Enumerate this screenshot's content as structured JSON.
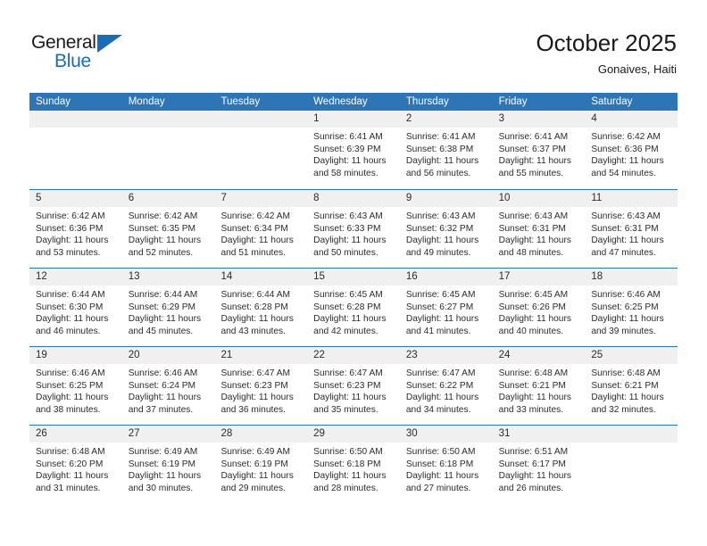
{
  "brand": {
    "name_top": "General",
    "name_bottom": "Blue",
    "accent_color": "#1a6cb5",
    "triangle_icon": "triangle-icon"
  },
  "header": {
    "title": "October 2025",
    "subtitle": "Gonaives, Haiti"
  },
  "theme": {
    "header_blue": "#2e75b6",
    "date_strip_gray": "#f0f0f0",
    "text_color": "#2b2b2b"
  },
  "weekdays": [
    "Sunday",
    "Monday",
    "Tuesday",
    "Wednesday",
    "Thursday",
    "Friday",
    "Saturday"
  ],
  "weeks": [
    [
      {
        "day": "",
        "sunrise": "",
        "sunset": "",
        "daylight1": "",
        "daylight2": ""
      },
      {
        "day": "",
        "sunrise": "",
        "sunset": "",
        "daylight1": "",
        "daylight2": ""
      },
      {
        "day": "",
        "sunrise": "",
        "sunset": "",
        "daylight1": "",
        "daylight2": ""
      },
      {
        "day": "1",
        "sunrise": "Sunrise: 6:41 AM",
        "sunset": "Sunset: 6:39 PM",
        "daylight1": "Daylight: 11 hours",
        "daylight2": "and 58 minutes."
      },
      {
        "day": "2",
        "sunrise": "Sunrise: 6:41 AM",
        "sunset": "Sunset: 6:38 PM",
        "daylight1": "Daylight: 11 hours",
        "daylight2": "and 56 minutes."
      },
      {
        "day": "3",
        "sunrise": "Sunrise: 6:41 AM",
        "sunset": "Sunset: 6:37 PM",
        "daylight1": "Daylight: 11 hours",
        "daylight2": "and 55 minutes."
      },
      {
        "day": "4",
        "sunrise": "Sunrise: 6:42 AM",
        "sunset": "Sunset: 6:36 PM",
        "daylight1": "Daylight: 11 hours",
        "daylight2": "and 54 minutes."
      }
    ],
    [
      {
        "day": "5",
        "sunrise": "Sunrise: 6:42 AM",
        "sunset": "Sunset: 6:36 PM",
        "daylight1": "Daylight: 11 hours",
        "daylight2": "and 53 minutes."
      },
      {
        "day": "6",
        "sunrise": "Sunrise: 6:42 AM",
        "sunset": "Sunset: 6:35 PM",
        "daylight1": "Daylight: 11 hours",
        "daylight2": "and 52 minutes."
      },
      {
        "day": "7",
        "sunrise": "Sunrise: 6:42 AM",
        "sunset": "Sunset: 6:34 PM",
        "daylight1": "Daylight: 11 hours",
        "daylight2": "and 51 minutes."
      },
      {
        "day": "8",
        "sunrise": "Sunrise: 6:43 AM",
        "sunset": "Sunset: 6:33 PM",
        "daylight1": "Daylight: 11 hours",
        "daylight2": "and 50 minutes."
      },
      {
        "day": "9",
        "sunrise": "Sunrise: 6:43 AM",
        "sunset": "Sunset: 6:32 PM",
        "daylight1": "Daylight: 11 hours",
        "daylight2": "and 49 minutes."
      },
      {
        "day": "10",
        "sunrise": "Sunrise: 6:43 AM",
        "sunset": "Sunset: 6:31 PM",
        "daylight1": "Daylight: 11 hours",
        "daylight2": "and 48 minutes."
      },
      {
        "day": "11",
        "sunrise": "Sunrise: 6:43 AM",
        "sunset": "Sunset: 6:31 PM",
        "daylight1": "Daylight: 11 hours",
        "daylight2": "and 47 minutes."
      }
    ],
    [
      {
        "day": "12",
        "sunrise": "Sunrise: 6:44 AM",
        "sunset": "Sunset: 6:30 PM",
        "daylight1": "Daylight: 11 hours",
        "daylight2": "and 46 minutes."
      },
      {
        "day": "13",
        "sunrise": "Sunrise: 6:44 AM",
        "sunset": "Sunset: 6:29 PM",
        "daylight1": "Daylight: 11 hours",
        "daylight2": "and 45 minutes."
      },
      {
        "day": "14",
        "sunrise": "Sunrise: 6:44 AM",
        "sunset": "Sunset: 6:28 PM",
        "daylight1": "Daylight: 11 hours",
        "daylight2": "and 43 minutes."
      },
      {
        "day": "15",
        "sunrise": "Sunrise: 6:45 AM",
        "sunset": "Sunset: 6:28 PM",
        "daylight1": "Daylight: 11 hours",
        "daylight2": "and 42 minutes."
      },
      {
        "day": "16",
        "sunrise": "Sunrise: 6:45 AM",
        "sunset": "Sunset: 6:27 PM",
        "daylight1": "Daylight: 11 hours",
        "daylight2": "and 41 minutes."
      },
      {
        "day": "17",
        "sunrise": "Sunrise: 6:45 AM",
        "sunset": "Sunset: 6:26 PM",
        "daylight1": "Daylight: 11 hours",
        "daylight2": "and 40 minutes."
      },
      {
        "day": "18",
        "sunrise": "Sunrise: 6:46 AM",
        "sunset": "Sunset: 6:25 PM",
        "daylight1": "Daylight: 11 hours",
        "daylight2": "and 39 minutes."
      }
    ],
    [
      {
        "day": "19",
        "sunrise": "Sunrise: 6:46 AM",
        "sunset": "Sunset: 6:25 PM",
        "daylight1": "Daylight: 11 hours",
        "daylight2": "and 38 minutes."
      },
      {
        "day": "20",
        "sunrise": "Sunrise: 6:46 AM",
        "sunset": "Sunset: 6:24 PM",
        "daylight1": "Daylight: 11 hours",
        "daylight2": "and 37 minutes."
      },
      {
        "day": "21",
        "sunrise": "Sunrise: 6:47 AM",
        "sunset": "Sunset: 6:23 PM",
        "daylight1": "Daylight: 11 hours",
        "daylight2": "and 36 minutes."
      },
      {
        "day": "22",
        "sunrise": "Sunrise: 6:47 AM",
        "sunset": "Sunset: 6:23 PM",
        "daylight1": "Daylight: 11 hours",
        "daylight2": "and 35 minutes."
      },
      {
        "day": "23",
        "sunrise": "Sunrise: 6:47 AM",
        "sunset": "Sunset: 6:22 PM",
        "daylight1": "Daylight: 11 hours",
        "daylight2": "and 34 minutes."
      },
      {
        "day": "24",
        "sunrise": "Sunrise: 6:48 AM",
        "sunset": "Sunset: 6:21 PM",
        "daylight1": "Daylight: 11 hours",
        "daylight2": "and 33 minutes."
      },
      {
        "day": "25",
        "sunrise": "Sunrise: 6:48 AM",
        "sunset": "Sunset: 6:21 PM",
        "daylight1": "Daylight: 11 hours",
        "daylight2": "and 32 minutes."
      }
    ],
    [
      {
        "day": "26",
        "sunrise": "Sunrise: 6:48 AM",
        "sunset": "Sunset: 6:20 PM",
        "daylight1": "Daylight: 11 hours",
        "daylight2": "and 31 minutes."
      },
      {
        "day": "27",
        "sunrise": "Sunrise: 6:49 AM",
        "sunset": "Sunset: 6:19 PM",
        "daylight1": "Daylight: 11 hours",
        "daylight2": "and 30 minutes."
      },
      {
        "day": "28",
        "sunrise": "Sunrise: 6:49 AM",
        "sunset": "Sunset: 6:19 PM",
        "daylight1": "Daylight: 11 hours",
        "daylight2": "and 29 minutes."
      },
      {
        "day": "29",
        "sunrise": "Sunrise: 6:50 AM",
        "sunset": "Sunset: 6:18 PM",
        "daylight1": "Daylight: 11 hours",
        "daylight2": "and 28 minutes."
      },
      {
        "day": "30",
        "sunrise": "Sunrise: 6:50 AM",
        "sunset": "Sunset: 6:18 PM",
        "daylight1": "Daylight: 11 hours",
        "daylight2": "and 27 minutes."
      },
      {
        "day": "31",
        "sunrise": "Sunrise: 6:51 AM",
        "sunset": "Sunset: 6:17 PM",
        "daylight1": "Daylight: 11 hours",
        "daylight2": "and 26 minutes."
      },
      {
        "day": "",
        "sunrise": "",
        "sunset": "",
        "daylight1": "",
        "daylight2": ""
      }
    ]
  ]
}
